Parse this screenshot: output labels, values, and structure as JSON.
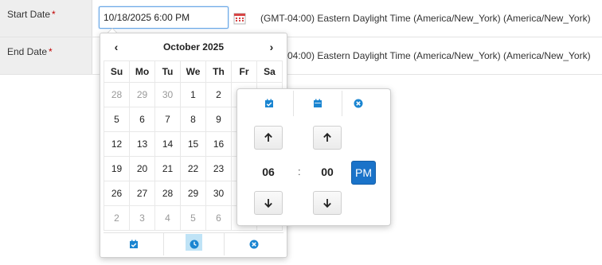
{
  "start_row": {
    "label": "Start Date",
    "required_mark": "*",
    "input_value": "10/18/2025 6:00 PM",
    "timezone": "(GMT-04:00) Eastern Daylight Time (America/New_York) (America/New_York)"
  },
  "end_row": {
    "label": "End Date",
    "required_mark": "*",
    "timezone": "(GMT-04:00) Eastern Daylight Time (America/New_York) (America/New_York)"
  },
  "datepicker": {
    "month_title": "October 2025",
    "prev_label": "‹",
    "next_label": "›",
    "weekdays": [
      "Su",
      "Mo",
      "Tu",
      "We",
      "Th",
      "Fr",
      "Sa"
    ],
    "weeks": [
      [
        "28",
        "29",
        "30",
        "1",
        "2",
        "3",
        "4"
      ],
      [
        "5",
        "6",
        "7",
        "8",
        "9",
        "10",
        "11"
      ],
      [
        "12",
        "13",
        "14",
        "15",
        "16",
        "17",
        "18"
      ],
      [
        "19",
        "20",
        "21",
        "22",
        "23",
        "24",
        "25"
      ],
      [
        "26",
        "27",
        "28",
        "29",
        "30",
        "31",
        "1"
      ],
      [
        "2",
        "3",
        "4",
        "5",
        "6",
        "7",
        "8"
      ]
    ]
  },
  "timepicker": {
    "hour": "06",
    "minute": "00",
    "separator": ":",
    "meridiem": "PM"
  },
  "colors": {
    "accent": "#1a73c9",
    "icon_blue": "#1a85d1",
    "connector": "#bfe3f6"
  }
}
